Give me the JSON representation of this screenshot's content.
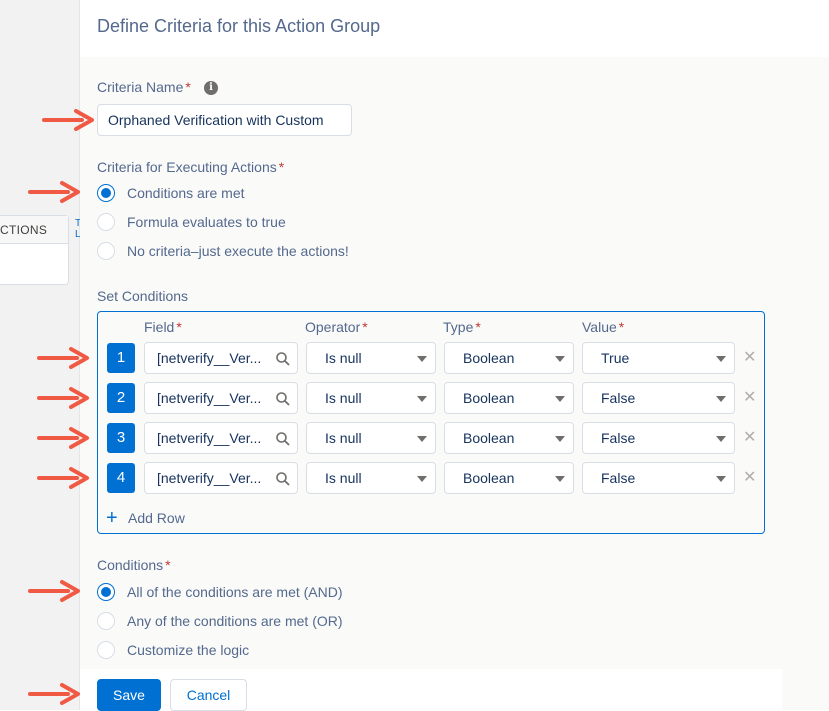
{
  "background": {
    "column_header": "CTIONS",
    "link_top": "T",
    "link_bottom": "L"
  },
  "panel": {
    "title": "Define Criteria for this Action Group"
  },
  "criteria_name": {
    "label": "Criteria Name",
    "required": "*",
    "info_icon": "i",
    "value": "Orphaned Verification with Custom"
  },
  "executing": {
    "label": "Criteria for Executing Actions",
    "required": "*",
    "options": [
      {
        "label": "Conditions are met",
        "selected": true
      },
      {
        "label": "Formula evaluates to true",
        "selected": false
      },
      {
        "label": "No criteria–just execute the actions!",
        "selected": false
      }
    ]
  },
  "set_conditions": {
    "label": "Set Conditions",
    "headers": {
      "field": "Field",
      "operator": "Operator",
      "type": "Type",
      "value": "Value",
      "required": "*"
    },
    "rows": [
      {
        "num": "1",
        "field": "[netverify__Ver...",
        "operator": "Is null",
        "type": "Boolean",
        "value": "True"
      },
      {
        "num": "2",
        "field": "[netverify__Ver...",
        "operator": "Is null",
        "type": "Boolean",
        "value": "False"
      },
      {
        "num": "3",
        "field": "[netverify__Ver...",
        "operator": "Is null",
        "type": "Boolean",
        "value": "False"
      },
      {
        "num": "4",
        "field": "[netverify__Ver...",
        "operator": "Is null",
        "type": "Boolean",
        "value": "False"
      }
    ],
    "delete_glyph": "✕",
    "add_row": "Add Row"
  },
  "conditions": {
    "label": "Conditions",
    "required": "*",
    "options": [
      {
        "label": "All of the conditions are met (AND)",
        "selected": true
      },
      {
        "label": "Any of the conditions are met (OR)",
        "selected": false
      },
      {
        "label": "Customize the logic",
        "selected": false
      }
    ]
  },
  "buttons": {
    "save": "Save",
    "cancel": "Cancel"
  },
  "colors": {
    "accent": "#0070d2",
    "arrow": "#f05a44",
    "text": "#54698d"
  }
}
